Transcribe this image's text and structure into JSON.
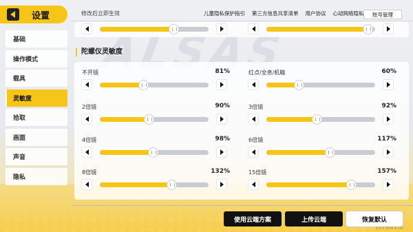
{
  "header": {
    "title": "设置",
    "hint": "修改后立即生效",
    "links": [
      "儿童隐私保护指引",
      "第三方信息共享清单",
      "用户协议",
      "心动网络隐私政策"
    ],
    "account_button": "账号管理"
  },
  "sidebar": {
    "items": [
      {
        "label": "基础",
        "active": false
      },
      {
        "label": "操作模式",
        "active": false
      },
      {
        "label": "载具",
        "active": false
      },
      {
        "label": "灵敏度",
        "active": true
      },
      {
        "label": "拾取",
        "active": false
      },
      {
        "label": "画面",
        "active": false
      },
      {
        "label": "声音",
        "active": false
      },
      {
        "label": "隐私",
        "active": false
      }
    ]
  },
  "top_sliders": [
    {
      "value": 0.68
    },
    {
      "value": 0.93
    }
  ],
  "section": {
    "title": "陀螺仪灵敏度",
    "sliders": [
      {
        "label": "不开镜",
        "value_text": "81%",
        "value": 0.4
      },
      {
        "label": "红点/全息/机瞄",
        "value_text": "60%",
        "value": 0.3
      },
      {
        "label": "2倍镜",
        "value_text": "90%",
        "value": 0.45
      },
      {
        "label": "3倍镜",
        "value_text": "92%",
        "value": 0.46
      },
      {
        "label": "4倍镜",
        "value_text": "98%",
        "value": 0.49
      },
      {
        "label": "6倍镜",
        "value_text": "117%",
        "value": 0.58
      },
      {
        "label": "8倍镜",
        "value_text": "132%",
        "value": 0.66
      },
      {
        "label": "15倍镜",
        "value_text": "157%",
        "value": 0.78
      }
    ]
  },
  "buttons": {
    "cloud_apply": "使用云端方案",
    "upload": "上传云端",
    "reset": "恢复默认"
  },
  "version": "1.0.0.10(6.0.16)",
  "colors": {
    "accent": "#f5c518",
    "dark": "#111111",
    "track": "#c9ccd2"
  }
}
